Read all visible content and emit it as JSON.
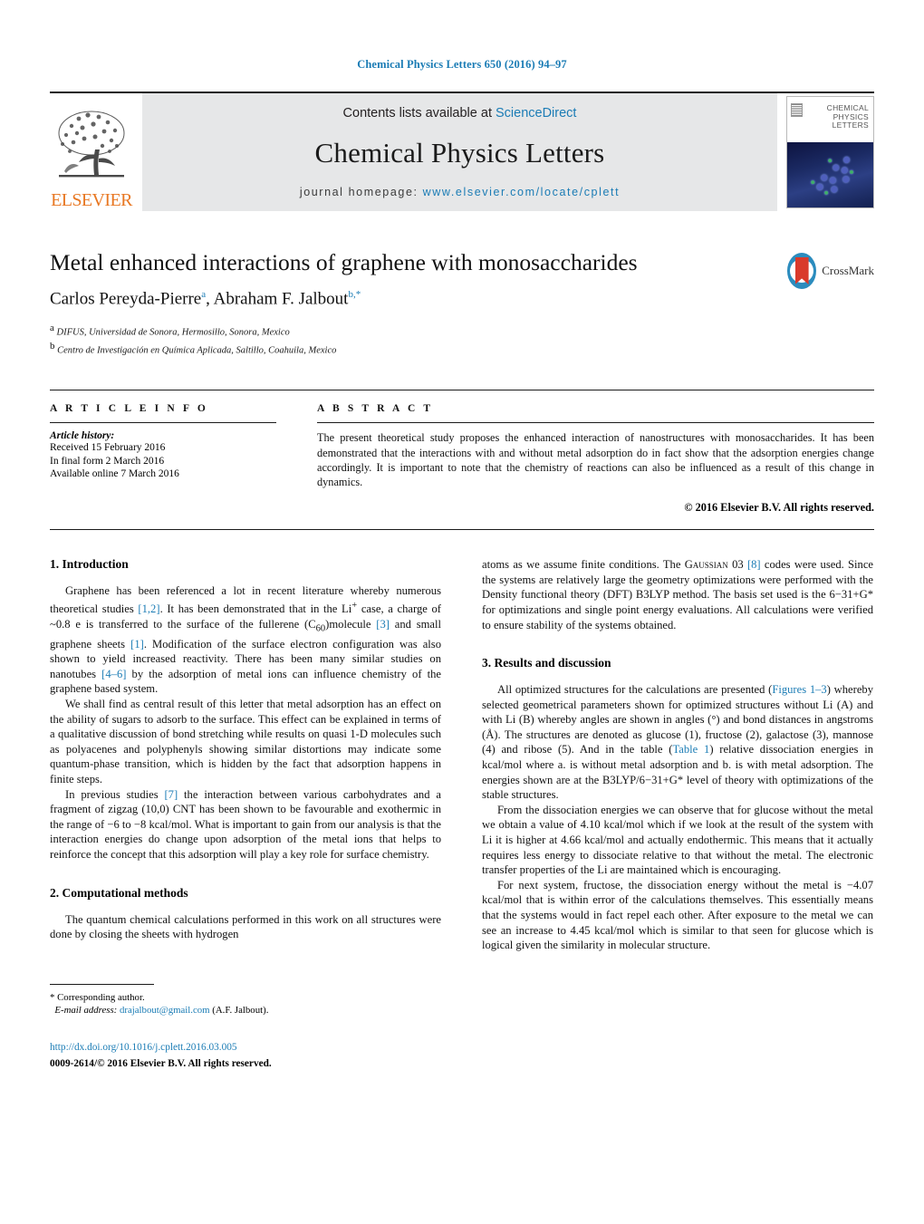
{
  "running_head": "Chemical Physics Letters 650 (2016) 94–97",
  "masthead": {
    "contents_prefix": "Contents lists available at ",
    "sciencedirect": "ScienceDirect",
    "journal_title": "Chemical Physics Letters",
    "homepage_label": "journal homepage:",
    "homepage_url": "www.elsevier.com/locate/cplett",
    "publisher_wordmark": "ELSEVIER",
    "cover_title_lines": [
      "CHEMICAL",
      "PHYSICS",
      "LETTERS"
    ],
    "accent_blue": "#1b7cb5",
    "elsevier_orange": "#e87722",
    "band_gray": "#e6e7e8"
  },
  "article": {
    "title": "Metal enhanced interactions of graphene with monosaccharides",
    "authors_html": "Carlos Pereyda-Pierre<sup>a</sup>, Abraham F. Jalbout<sup>b,*</sup>",
    "affiliations": [
      {
        "marker": "a",
        "text": "DIFUS, Universidad de Sonora, Hermosillo, Sonora, Mexico"
      },
      {
        "marker": "b",
        "text": "Centro de Investigación en Química Aplicada, Saltillo, Coahuila, Mexico"
      }
    ],
    "crossmark_label": "CrossMark"
  },
  "info": {
    "label": "A R T I C L E   I N F O",
    "history_title": "Article history:",
    "history": [
      "Received 15 February 2016",
      "In final form 2 March 2016",
      "Available online 7 March 2016"
    ]
  },
  "abstract": {
    "label": "A B S T R A C T",
    "text": "The present theoretical study proposes the enhanced interaction of nanostructures with monosaccharides. It has been demonstrated that the interactions with and without metal adsorption do in fact show that the adsorption energies change accordingly. It is important to note that the chemistry of reactions can also be influenced as a result of this change in dynamics.",
    "copyright": "© 2016 Elsevier B.V. All rights reserved."
  },
  "sections": {
    "introduction": {
      "heading": "1. Introduction",
      "p1_a": "Graphene has been referenced a lot in recent literature whereby numerous theoretical studies ",
      "p1_ref1": "[1,2]",
      "p1_b": ". It has been demonstrated that in the Li",
      "p1_c": " case, a charge of ~0.8 e is transferred to the surface of the fullerene (C",
      "p1_sub": "60",
      "p1_d": ")molecule ",
      "p1_ref2": "[3]",
      "p1_e": " and small graphene sheets ",
      "p1_ref3": "[1]",
      "p1_f": ". Modification of the surface electron configuration was also shown to yield increased reactivity. There has been many similar studies on nanotubes ",
      "p1_ref4": "[4–6]",
      "p1_g": " by the adsorption of metal ions can influence chemistry of the graphene based system.",
      "p2": "We shall find as central result of this letter that metal adsorption has an effect on the ability of sugars to adsorb to the surface. This effect can be explained in terms of a qualitative discussion of bond stretching while results on quasi 1-D molecules such as polyacenes and polyphenyls showing similar distortions may indicate some quantum-phase transition, which is hidden by the fact that adsorption happens in finite steps.",
      "p3_a": "In previous studies ",
      "p3_ref": "[7]",
      "p3_b": " the interaction between various carbohydrates and a fragment of zigzag (10,0) CNT has been shown to be favourable and exothermic in the range of −6 to −8 kcal/mol. What is important to gain from our analysis is that the interaction energies do change upon adsorption of the metal ions that helps to reinforce the concept that this adsorption will play a key role for surface chemistry."
    },
    "methods": {
      "heading": "2. Computational methods",
      "p1": "The quantum chemical calculations performed in this work on all structures were done by closing the sheets with hydrogen",
      "p1_cont_a": "atoms as we assume finite conditions. The ",
      "p1_cont_gaussian": "Gaussian",
      "p1_cont_b": " 03 ",
      "p1_cont_ref": "[8]",
      "p1_cont_c": " codes were used. Since the systems are relatively large the geometry optimizations were performed with the Density functional theory (DFT) B3LYP method. The basis set used is the 6−31+G* for optimizations and single point energy evaluations. All calculations were verified to ensure stability of the systems obtained."
    },
    "results": {
      "heading": "3. Results and discussion",
      "p1_a": "All optimized structures for the calculations are presented (",
      "p1_figref": "Figures 1–3",
      "p1_b": ") whereby selected geometrical parameters shown for optimized structures without Li (A) and with Li (B) whereby angles are shown in angles (°) and bond distances in angstroms (Å). The structures are denoted as glucose (1), fructose (2), galactose (3), mannose (4) and ribose (5). And in the table (",
      "p1_tableref": "Table 1",
      "p1_c": ") relative dissociation energies in kcal/mol where a. is without metal adsorption and b. is with metal adsorption. The energies shown are at the B3LYP/6−31+G* level of theory with optimizations of the stable structures.",
      "p2": "From the dissociation energies we can observe that for glucose without the metal we obtain a value of 4.10 kcal/mol which if we look at the result of the system with Li it is higher at 4.66 kcal/mol and actually endothermic. This means that it actually requires less energy to dissociate relative to that without the metal. The electronic transfer properties of the Li are maintained which is encouraging.",
      "p3": "For next system, fructose, the dissociation energy without the metal is −4.07 kcal/mol that is within error of the calculations themselves. This essentially means that the systems would in fact repel each other. After exposure to the metal we can see an increase to 4.45 kcal/mol which is similar to that seen for glucose which is logical given the similarity in molecular structure."
    }
  },
  "footnote": {
    "corresponding": "* Corresponding author.",
    "email_label": "E-mail address:",
    "email": "drajalbout@gmail.com",
    "email_owner": "(A.F. Jalbout)."
  },
  "footer": {
    "doi": "http://dx.doi.org/10.1016/j.cplett.2016.03.005",
    "issn": "0009-2614/© 2016 Elsevier B.V. All rights reserved."
  }
}
